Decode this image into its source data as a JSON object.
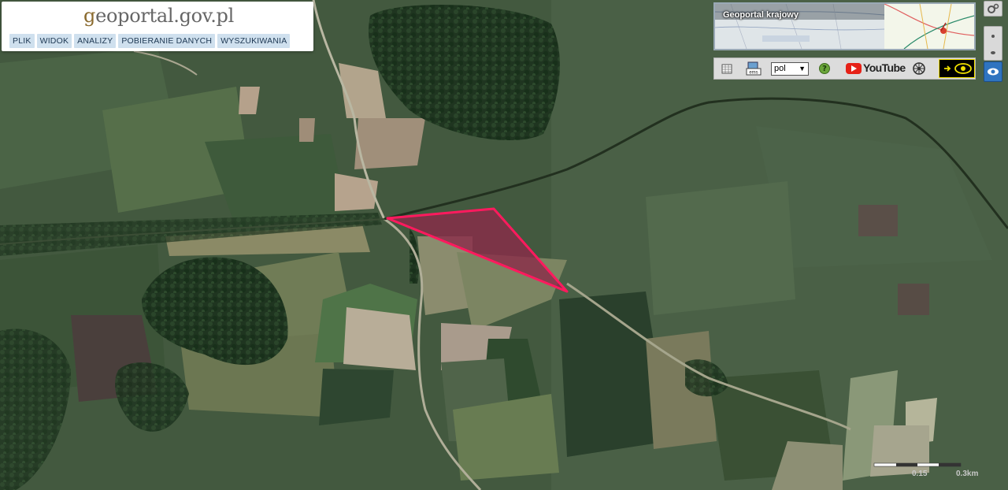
{
  "header": {
    "logo_g": "g",
    "logo_rest": "eoportal.gov.pl",
    "menu": [
      {
        "label": "PLIK"
      },
      {
        "label": "WIDOK"
      },
      {
        "label": "ANALIZY"
      },
      {
        "label": "POBIERANIE DANYCH"
      },
      {
        "label": "WYSZUKIWANIA"
      }
    ]
  },
  "overview": {
    "title": "Geoportal krajowy"
  },
  "toolbar": {
    "language_value": "pol",
    "youtube_label": "YouTube",
    "icons": [
      "table-icon",
      "ems-icon",
      "language-select",
      "help-icon",
      "youtube-icon",
      "wheel-icon",
      "accessibility-eye-icon"
    ]
  },
  "scale": {
    "label_mid": "0.15",
    "label_end": "0.3km"
  },
  "colors": {
    "parcel_fill": "#8b2a4a",
    "parcel_stroke": "#ff1a5e",
    "menu_bg": "#cfe0ee",
    "logo_g": "#8a6a2e"
  }
}
